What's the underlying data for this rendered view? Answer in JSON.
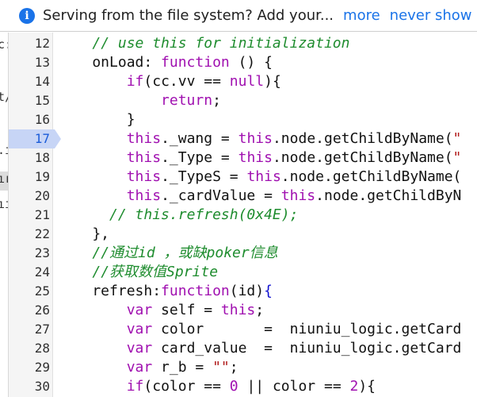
{
  "infobar": {
    "message": "Serving from the file system? Add your...",
    "more": "more",
    "never_show": "never show"
  },
  "left_pane": {
    "fragments": [
      "c:",
      "t/",
      ".i",
      "ır",
      "ııs"
    ]
  },
  "editor": {
    "active_line": 17,
    "lines": [
      {
        "n": "12",
        "parts": [
          {
            "t": "    ",
            "c": ""
          },
          {
            "t": "// use this for initialization",
            "c": "cm"
          }
        ]
      },
      {
        "n": "13",
        "parts": [
          {
            "t": "    onLoad: ",
            "c": ""
          },
          {
            "t": "function",
            "c": "kw"
          },
          {
            "t": " () {",
            "c": ""
          }
        ]
      },
      {
        "n": "14",
        "parts": [
          {
            "t": "        ",
            "c": ""
          },
          {
            "t": "if",
            "c": "kw"
          },
          {
            "t": "(cc.vv == ",
            "c": ""
          },
          {
            "t": "null",
            "c": "kw"
          },
          {
            "t": "){",
            "c": ""
          }
        ]
      },
      {
        "n": "15",
        "parts": [
          {
            "t": "            ",
            "c": ""
          },
          {
            "t": "return",
            "c": "kw"
          },
          {
            "t": ";",
            "c": ""
          }
        ]
      },
      {
        "n": "16",
        "parts": [
          {
            "t": "        }",
            "c": ""
          }
        ]
      },
      {
        "n": "17",
        "parts": [
          {
            "t": "        ",
            "c": ""
          },
          {
            "t": "this",
            "c": "kw"
          },
          {
            "t": "._wang = ",
            "c": ""
          },
          {
            "t": "this",
            "c": "kw"
          },
          {
            "t": ".node.getChildByName(",
            "c": ""
          },
          {
            "t": "\"",
            "c": "str"
          }
        ]
      },
      {
        "n": "18",
        "parts": [
          {
            "t": "        ",
            "c": ""
          },
          {
            "t": "this",
            "c": "kw"
          },
          {
            "t": "._Type = ",
            "c": ""
          },
          {
            "t": "this",
            "c": "kw"
          },
          {
            "t": ".node.getChildByName(",
            "c": ""
          },
          {
            "t": "\"",
            "c": "str"
          }
        ]
      },
      {
        "n": "19",
        "parts": [
          {
            "t": "        ",
            "c": ""
          },
          {
            "t": "this",
            "c": "kw"
          },
          {
            "t": "._TypeS = ",
            "c": ""
          },
          {
            "t": "this",
            "c": "kw"
          },
          {
            "t": ".node.getChildByName(",
            "c": ""
          }
        ]
      },
      {
        "n": "20",
        "parts": [
          {
            "t": "        ",
            "c": ""
          },
          {
            "t": "this",
            "c": "kw"
          },
          {
            "t": "._cardValue = ",
            "c": ""
          },
          {
            "t": "this",
            "c": "kw"
          },
          {
            "t": ".node.getChildByN",
            "c": ""
          }
        ]
      },
      {
        "n": "21",
        "parts": [
          {
            "t": "      ",
            "c": ""
          },
          {
            "t": "// this.refresh(0x4E);",
            "c": "cm"
          }
        ]
      },
      {
        "n": "22",
        "parts": [
          {
            "t": "    },",
            "c": ""
          }
        ]
      },
      {
        "n": "23",
        "parts": [
          {
            "t": "    ",
            "c": ""
          },
          {
            "t": "//通过id ，或缺poker信息",
            "c": "cm"
          }
        ]
      },
      {
        "n": "24",
        "parts": [
          {
            "t": "    ",
            "c": ""
          },
          {
            "t": "//获取数值Sprite",
            "c": "cm"
          }
        ]
      },
      {
        "n": "25",
        "parts": [
          {
            "t": "    refresh:",
            "c": ""
          },
          {
            "t": "function",
            "c": "kw"
          },
          {
            "t": "(id)",
            "c": ""
          },
          {
            "t": "{",
            "c": "sb"
          }
        ]
      },
      {
        "n": "26",
        "parts": [
          {
            "t": "        ",
            "c": ""
          },
          {
            "t": "var",
            "c": "kw"
          },
          {
            "t": " self = ",
            "c": ""
          },
          {
            "t": "this",
            "c": "kw"
          },
          {
            "t": ";",
            "c": ""
          }
        ]
      },
      {
        "n": "27",
        "parts": [
          {
            "t": "        ",
            "c": ""
          },
          {
            "t": "var",
            "c": "kw"
          },
          {
            "t": " color       =  niuniu_logic.getCard",
            "c": ""
          }
        ]
      },
      {
        "n": "28",
        "parts": [
          {
            "t": "        ",
            "c": ""
          },
          {
            "t": "var",
            "c": "kw"
          },
          {
            "t": " card_value  =  niuniu_logic.getCard",
            "c": ""
          }
        ]
      },
      {
        "n": "29",
        "parts": [
          {
            "t": "        ",
            "c": ""
          },
          {
            "t": "var",
            "c": "kw"
          },
          {
            "t": " r_b = ",
            "c": ""
          },
          {
            "t": "\"\"",
            "c": "str"
          },
          {
            "t": ";",
            "c": ""
          }
        ]
      },
      {
        "n": "30",
        "parts": [
          {
            "t": "        ",
            "c": ""
          },
          {
            "t": "if",
            "c": "kw"
          },
          {
            "t": "(color == ",
            "c": ""
          },
          {
            "t": "0",
            "c": "kw"
          },
          {
            "t": " || color == ",
            "c": ""
          },
          {
            "t": "2",
            "c": "kw"
          },
          {
            "t": "){",
            "c": ""
          }
        ]
      }
    ]
  }
}
